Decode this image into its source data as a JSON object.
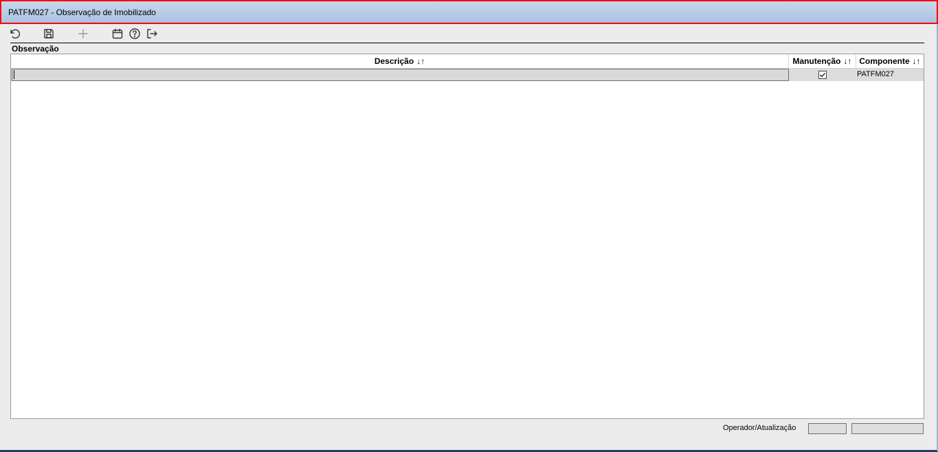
{
  "window": {
    "title": "PATFM027 - Observação de Imobilizado"
  },
  "toolbar": {
    "buttons": [
      {
        "name": "undo-button",
        "icon": "undo-icon",
        "enabled": true
      },
      {
        "name": "save-button",
        "icon": "save-icon",
        "enabled": true
      },
      {
        "name": "add-button",
        "icon": "plus-icon",
        "enabled": false
      },
      {
        "name": "calendar-button",
        "icon": "calendar-icon",
        "enabled": true
      },
      {
        "name": "help-button",
        "icon": "help-icon",
        "enabled": true
      },
      {
        "name": "exit-button",
        "icon": "exit-icon",
        "enabled": true
      }
    ]
  },
  "section": {
    "title": "Observação"
  },
  "grid": {
    "columns": [
      {
        "label": "Descrição",
        "sort": "↓↑"
      },
      {
        "label": "Manutenção",
        "sort": "↓↑"
      },
      {
        "label": "Componente",
        "sort": "↓↑"
      }
    ],
    "rows": [
      {
        "descricao": "",
        "manutencao": true,
        "componente": "PATFM027"
      }
    ]
  },
  "footer": {
    "operator_label": "Operador/Atualização",
    "operator_value": "",
    "update_value": ""
  }
}
